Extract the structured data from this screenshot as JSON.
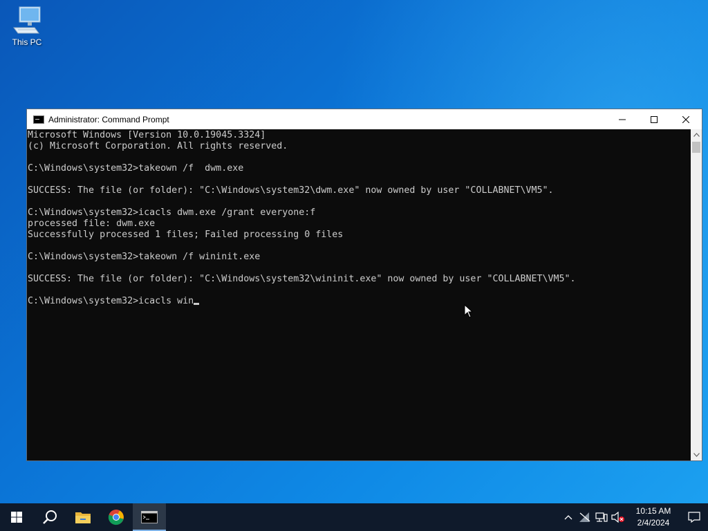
{
  "desktop": {
    "icons": [
      {
        "label": "This PC",
        "icon": "computer-icon"
      }
    ]
  },
  "window": {
    "title": "Administrator: Command Prompt",
    "controls": {
      "minimize": "minimize-icon",
      "maximize": "maximize-icon",
      "close": "close-icon"
    }
  },
  "console": {
    "lines": [
      "Microsoft Windows [Version 10.0.19045.3324]",
      "(c) Microsoft Corporation. All rights reserved.",
      "",
      "C:\\Windows\\system32>takeown /f  dwm.exe",
      "",
      "SUCCESS: The file (or folder): \"C:\\Windows\\system32\\dwm.exe\" now owned by user \"COLLABNET\\VM5\".",
      "",
      "C:\\Windows\\system32>icacls dwm.exe /grant everyone:f",
      "processed file: dwm.exe",
      "Successfully processed 1 files; Failed processing 0 files",
      "",
      "C:\\Windows\\system32>takeown /f wininit.exe",
      "",
      "SUCCESS: The file (or folder): \"C:\\Windows\\system32\\wininit.exe\" now owned by user \"COLLABNET\\VM5\".",
      ""
    ],
    "current_input": "C:\\Windows\\system32>icacls win"
  },
  "taskbar": {
    "items": [
      {
        "name": "start-button",
        "icon": "windows-logo-icon"
      },
      {
        "name": "search-button",
        "icon": "search-icon"
      },
      {
        "name": "file-explorer",
        "icon": "folder-icon"
      },
      {
        "name": "chrome",
        "icon": "chrome-icon"
      },
      {
        "name": "command-prompt",
        "icon": "cmd-icon",
        "active": true
      }
    ],
    "tray": {
      "icons": [
        "chevron-up-icon",
        "network-disconnected-icon",
        "network-icon",
        "volume-muted-icon"
      ],
      "time": "10:15 AM",
      "date": "2/4/2024"
    }
  },
  "colors": {
    "console_bg": "#0c0c0c",
    "console_fg": "#cccccc",
    "taskbar_bg": "#0f1a2b",
    "desktop_accent": "#0b74d6"
  }
}
